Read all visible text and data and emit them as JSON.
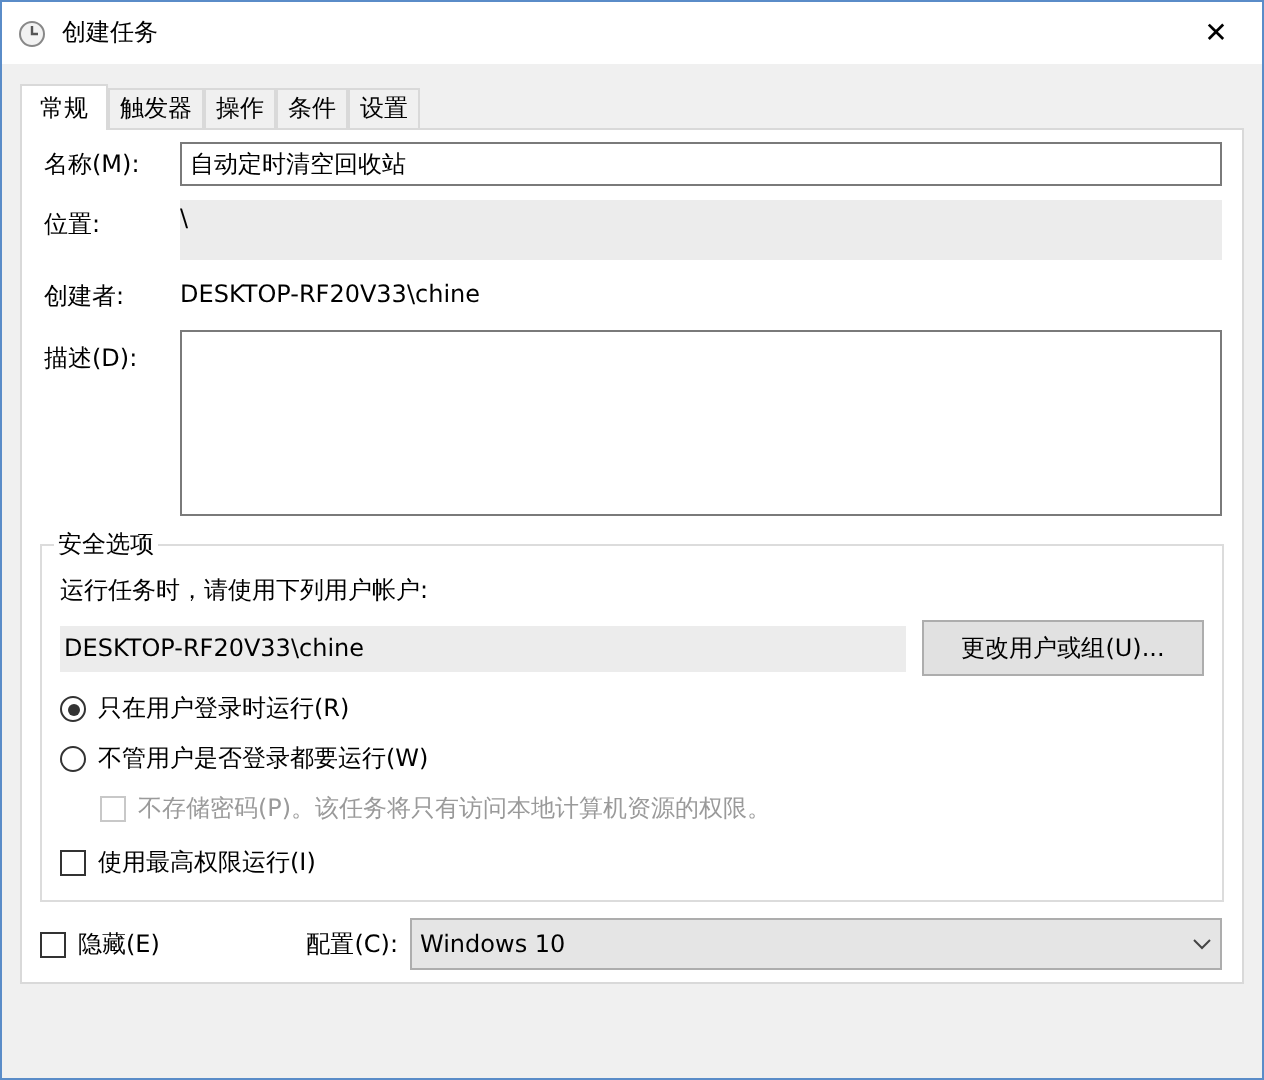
{
  "window": {
    "title": "创建任务",
    "close": "✕"
  },
  "tabs": [
    {
      "label": "常规",
      "selected": true
    },
    {
      "label": "触发器",
      "selected": false
    },
    {
      "label": "操作",
      "selected": false
    },
    {
      "label": "条件",
      "selected": false
    },
    {
      "label": "设置",
      "selected": false
    }
  ],
  "general": {
    "name_label": "名称(M):",
    "name_value": "自动定时清空回收站",
    "location_label": "位置:",
    "location_value": "\\",
    "author_label": "创建者:",
    "author_value": "DESKTOP-RF20V33\\chine",
    "description_label": "描述(D):"
  },
  "security": {
    "legend": "安全选项",
    "account_prompt": "运行任务时，请使用下列用户帐户:",
    "account_value": "DESKTOP-RF20V33\\chine",
    "change_button": "更改用户或组(U)...",
    "options": [
      {
        "kind": "radio",
        "label": "只在用户登录时运行(R)",
        "checked": true,
        "disabled": false
      },
      {
        "kind": "radio",
        "label": "不管用户是否登录都要运行(W)",
        "checked": false,
        "disabled": false,
        "children": [
          {
            "kind": "checkbox",
            "label": "不存储密码(P)。该任务将只有访问本地计算机资源的权限。",
            "checked": false,
            "disabled": true
          }
        ]
      },
      {
        "kind": "checkbox",
        "label": "使用最高权限运行(I)",
        "checked": false,
        "disabled": false
      }
    ]
  },
  "hidden": {
    "label": "隐藏(E)",
    "checked": false
  },
  "config": {
    "label": "配置(C):",
    "value": "Windows 10"
  }
}
